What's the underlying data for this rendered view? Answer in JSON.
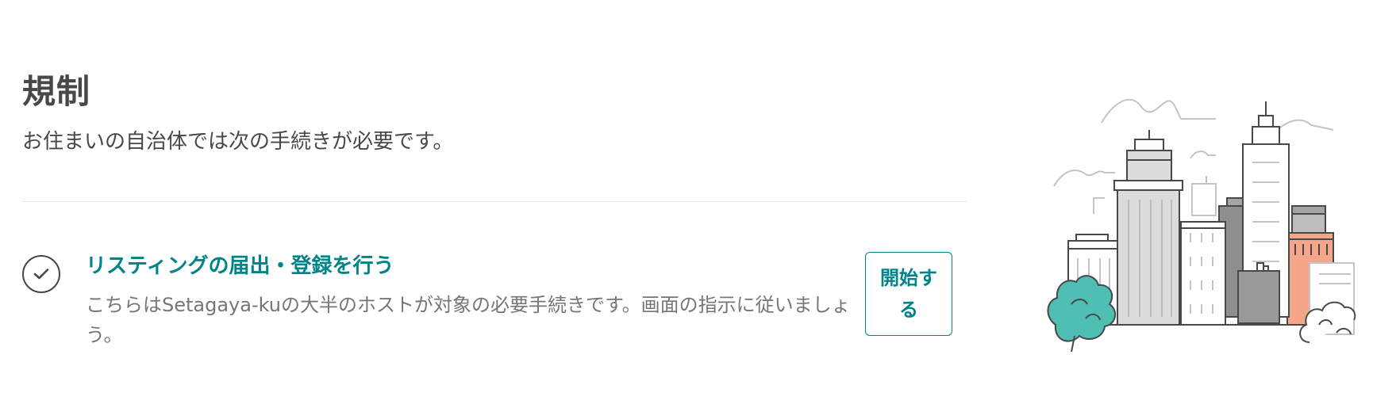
{
  "regulations": {
    "title": "規制",
    "subtitle": "お住まいの自治体では次の手続きが必要です。",
    "requirement": {
      "title": "リスティングの届出・登録を行う",
      "description": "こちらはSetagaya-kuの大半のホストが対象の必要手続きです。画面の指示に従いましょう。",
      "button_label": "開始する",
      "status_icon": "check-icon"
    }
  },
  "colors": {
    "accent": "#00848a",
    "text": "#484848",
    "muted_text": "#767676",
    "tree": "#4fbfb3",
    "building_accent": "#f4a58a"
  },
  "illustration": {
    "icon": "city-buildings-illustration"
  }
}
